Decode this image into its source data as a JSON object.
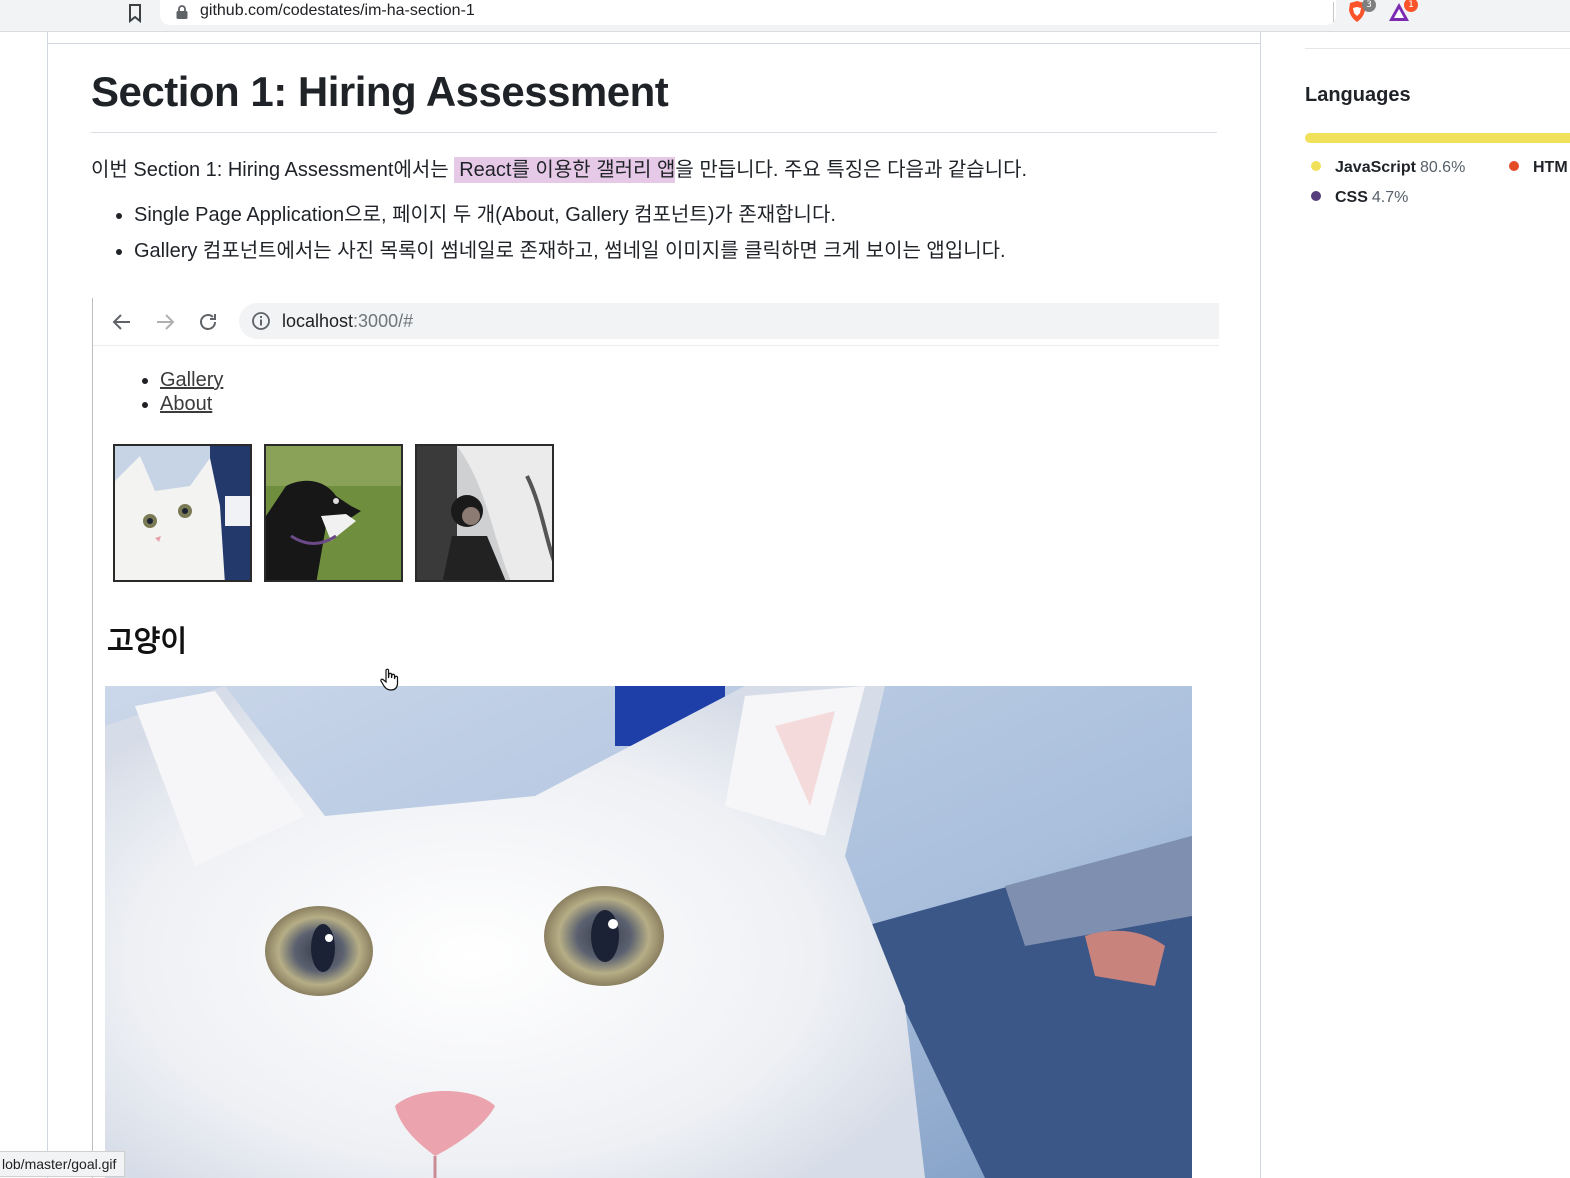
{
  "browser": {
    "url": "github.com/codestates/im-ha-section-1",
    "extensions": [
      {
        "name": "brave-shield-icon",
        "badge": "3",
        "color": "#fb542b"
      },
      {
        "name": "brave-rewards-icon",
        "badge": "1",
        "color": "#7b2bb2"
      }
    ],
    "status_url": "lob/master/goal.gif"
  },
  "readme": {
    "title": "Section 1: Hiring Assessment",
    "intro_before": "이번 Section 1: Hiring Assessment에서는 ",
    "intro_highlight": "React를 이용한 갤러리 앱",
    "intro_after": "을 만듭니다. 주요 특징은 다음과 같습니다.",
    "bullets": [
      "Single Page Application으로, 페이지 두 개(About, Gallery 컴포넌트)가 존재합니다.",
      "Gallery 컴포넌트에서는 사진 목록이 썸네일로 존재하고, 썸네일 이미지를 클릭하면 크게 보이는 앱입니다."
    ],
    "highlight_color": "#e6c9e6"
  },
  "demo": {
    "url_host": "localhost",
    "url_rest": ":3000/#",
    "nav_links": [
      "Gallery",
      "About"
    ],
    "thumbnails": [
      "cat-thumbnail",
      "dog-thumbnail",
      "woman-thumbnail"
    ],
    "selected_title": "고양이"
  },
  "sidebar": {
    "languages_heading": "Languages",
    "languages": [
      {
        "name": "JavaScript",
        "percent": "80.6%",
        "color": "#f1e05a"
      },
      {
        "name": "HTM",
        "percent": "",
        "color": "#e34c26"
      },
      {
        "name": "CSS",
        "percent": "4.7%",
        "color": "#563d7c"
      }
    ]
  }
}
